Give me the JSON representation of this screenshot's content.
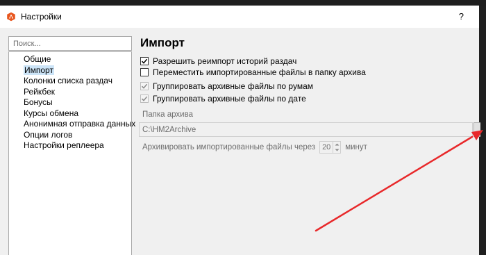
{
  "window": {
    "title": "Настройки",
    "help_label": "?"
  },
  "sidebar": {
    "search_placeholder": "Поиск...",
    "items": [
      {
        "label": "Общие"
      },
      {
        "label": "Импорт"
      },
      {
        "label": "Колонки списка раздач"
      },
      {
        "label": "Рейкбек"
      },
      {
        "label": "Бонусы"
      },
      {
        "label": "Курсы обмена"
      },
      {
        "label": "Анонимная отправка данных"
      },
      {
        "label": "Опции логов"
      },
      {
        "label": "Настройки реплеера"
      }
    ],
    "selected_index": 1
  },
  "main": {
    "title": "Импорт",
    "checkboxes": [
      {
        "label": "Разрешить реимпорт историй раздач",
        "checked": true,
        "enabled": true
      },
      {
        "label": "Переместить импортированные файлы в папку архива",
        "checked": false,
        "enabled": true
      },
      {
        "label": "Группировать архивные файлы по румам",
        "checked": true,
        "enabled": false
      },
      {
        "label": "Группировать архивные файлы по дате",
        "checked": true,
        "enabled": false
      }
    ],
    "archive_group_label": "Папка архива",
    "archive_path": "C:\\HM2Archive",
    "archive_interval_label": "Архивировать импортированные файлы через",
    "archive_interval_value": "20",
    "archive_interval_unit": "минут"
  },
  "colors": {
    "selection": "#cce4f7",
    "annotation_arrow": "#e8282a",
    "app_icon": "#e8561e"
  },
  "icons": {
    "app": "hm2-logo-icon",
    "check": "checkmark-icon",
    "spin_up": "chevron-up-icon",
    "spin_down": "chevron-down-icon"
  }
}
